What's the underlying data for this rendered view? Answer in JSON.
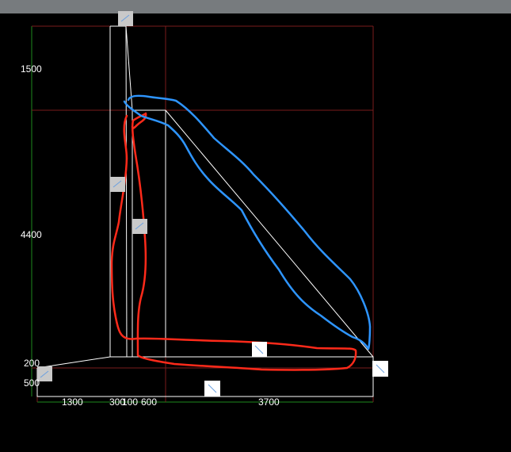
{
  "colors": {
    "background": "#000000",
    "topbar": "#777b7e",
    "outline": "#ffffff",
    "grid": "#7a1d1d",
    "dim_line": "#1e8a1e",
    "annotation_red": "#ff2a1a",
    "annotation_blue": "#2e95ff"
  },
  "dimensions": {
    "vertical": {
      "d1500": "1500",
      "d4400": "4400",
      "d200": "200",
      "d500": "500"
    },
    "horizontal": {
      "d1300": "1300",
      "d300": "300",
      "d100": "100",
      "d600": "600",
      "d3700": "3700"
    }
  },
  "icons": {
    "grip_handle": "square-grip-icon"
  }
}
